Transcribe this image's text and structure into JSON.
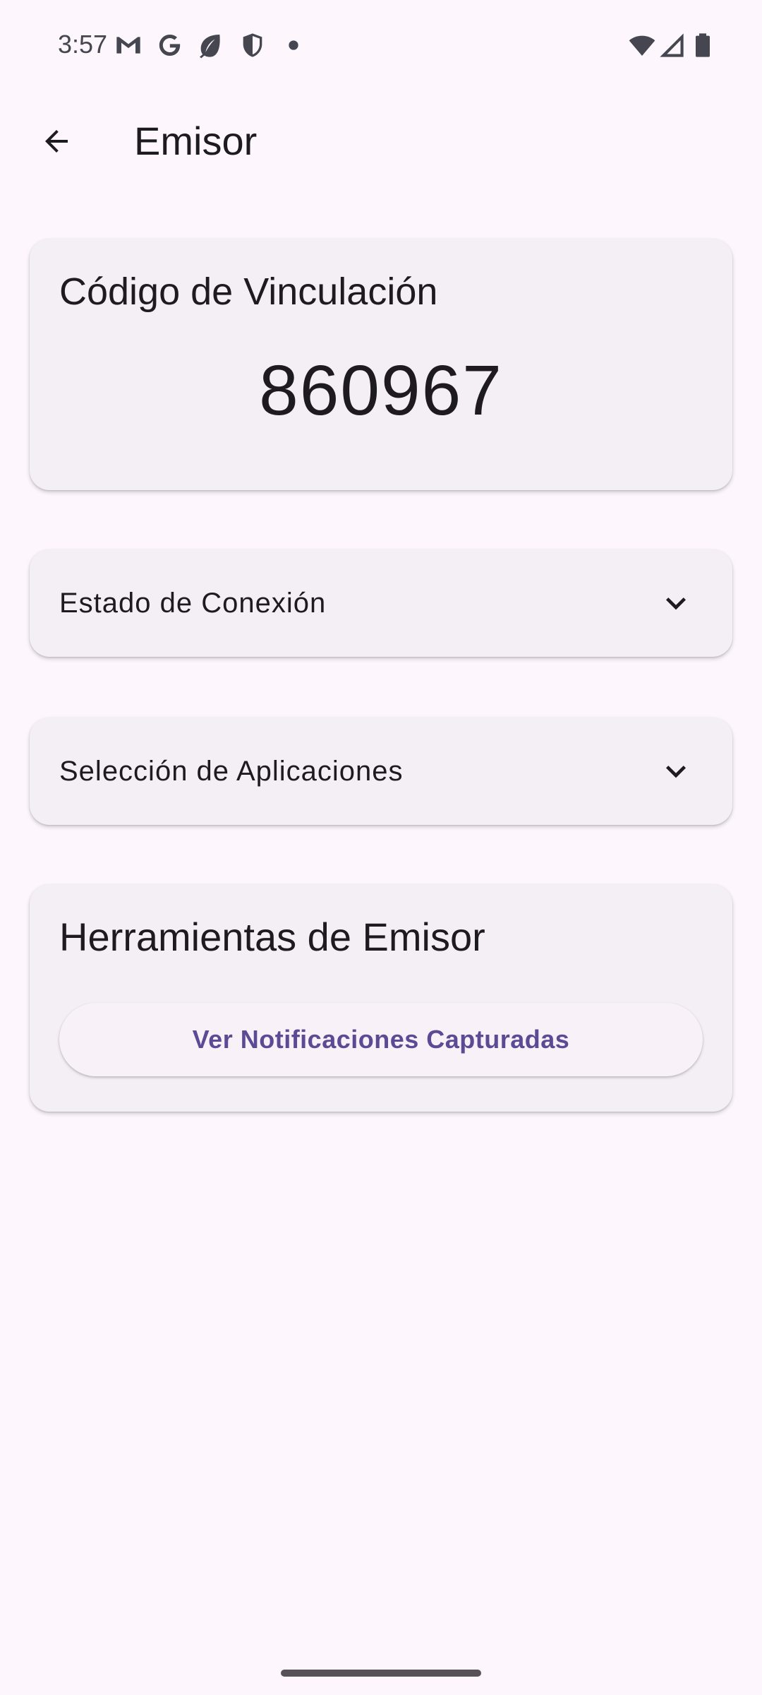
{
  "status_bar": {
    "time": "3:57",
    "left_icons": [
      "gmail-icon",
      "google-icon",
      "leaf-icon",
      "shield-icon",
      "dot-icon"
    ],
    "right_icons": [
      "wifi-icon",
      "cellular-signal-icon",
      "battery-icon"
    ]
  },
  "app_bar": {
    "title": "Emisor",
    "back_icon": "arrow-back-icon"
  },
  "link_code_card": {
    "title": "Código de Vinculación",
    "code": "860967"
  },
  "connection_card": {
    "label": "Estado de Conexión",
    "icon": "chevron-down-icon"
  },
  "apps_card": {
    "label": "Selección de Aplicaciones",
    "icon": "chevron-down-icon"
  },
  "tools_card": {
    "title": "Herramientas de Emisor",
    "button_label": "Ver Notificaciones Capturadas"
  },
  "colors": {
    "background": "#FDF7FD",
    "card": "#F4EFF4",
    "accent": "#5D4A94",
    "text": "#1D1B20"
  }
}
